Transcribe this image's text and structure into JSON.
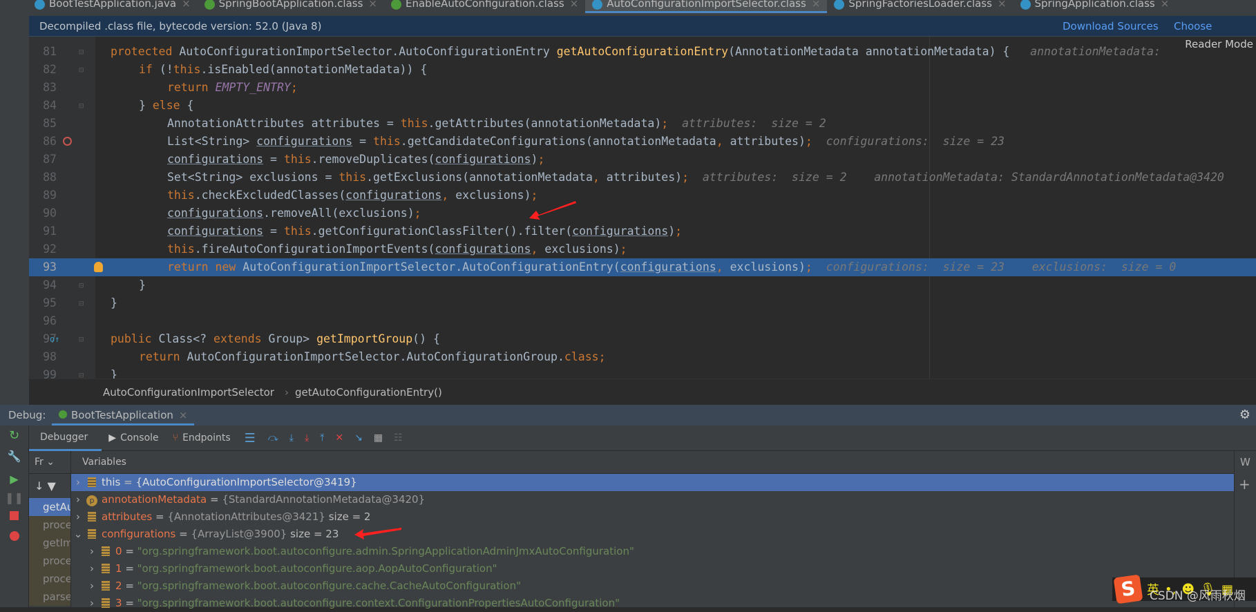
{
  "tabs": [
    {
      "label": "BootTestApplication.java",
      "icon": "java-class-icon",
      "active": false
    },
    {
      "label": "SpringBootApplication.class",
      "icon": "annotation-icon",
      "active": false
    },
    {
      "label": "EnableAutoConfiguration.class",
      "icon": "annotation-icon",
      "active": false
    },
    {
      "label": "AutoConfigurationImportSelector.class",
      "icon": "class-icon",
      "active": true
    },
    {
      "label": "SpringFactoriesLoader.class",
      "icon": "class-icon",
      "active": false
    },
    {
      "label": "SpringApplication.class",
      "icon": "class-icon",
      "active": false
    }
  ],
  "banner": {
    "text": "Decompiled .class file, bytecode version: 52.0 (Java 8)",
    "download": "Download Sources",
    "choose": "Choose Sources"
  },
  "reader_mode": "Reader Mode",
  "code": [
    {
      "n": "81",
      "ind": 1,
      "fold": true,
      "tokens": [
        [
          "kw",
          "protected "
        ],
        [
          "",
          "AutoConfigurationImportSelector.AutoConfigurationEntry "
        ],
        [
          "fn",
          "getAutoConfigurationEntry"
        ],
        [
          "",
          "(AnnotationMetadata annotationMetadata) {   "
        ],
        [
          "hint",
          "annotationMetadata: "
        ]
      ]
    },
    {
      "n": "82",
      "ind": 2,
      "fold": true,
      "tokens": [
        [
          "kw",
          "if "
        ],
        [
          "",
          "(!"
        ],
        [
          "kw",
          "this"
        ],
        [
          "",
          ".isEnabled(annotationMetadata)) {"
        ]
      ]
    },
    {
      "n": "83",
      "ind": 3,
      "tokens": [
        [
          "kw",
          "return "
        ],
        [
          "it",
          "EMPTY_ENTRY"
        ],
        [
          "kw",
          ";"
        ]
      ]
    },
    {
      "n": "84",
      "ind": 2,
      "fold": true,
      "tokens": [
        [
          "",
          "} "
        ],
        [
          "kw",
          "else "
        ],
        [
          "",
          "{"
        ]
      ]
    },
    {
      "n": "85",
      "ind": 3,
      "tokens": [
        [
          "",
          "AnnotationAttributes attributes = "
        ],
        [
          "kw",
          "this"
        ],
        [
          "",
          ".getAttributes(annotationMetadata)"
        ],
        [
          "kw",
          ";"
        ],
        [
          "hint",
          "  attributes:  size = 2"
        ]
      ]
    },
    {
      "n": "86",
      "ind": 3,
      "bp": true,
      "tokens": [
        [
          "",
          "List<String> "
        ],
        [
          "ul",
          "configurations"
        ],
        [
          "",
          " = "
        ],
        [
          "kw",
          "this"
        ],
        [
          "",
          ".getCandidateConfigurations(annotationMetadata"
        ],
        [
          "kw",
          ","
        ],
        [
          "",
          " attributes)"
        ],
        [
          "kw",
          ";"
        ],
        [
          "hint",
          "  configurations:  size = 23"
        ]
      ]
    },
    {
      "n": "87",
      "ind": 3,
      "tokens": [
        [
          "ul",
          "configurations"
        ],
        [
          "",
          " = "
        ],
        [
          "kw",
          "this"
        ],
        [
          "",
          ".removeDuplicates("
        ],
        [
          "ul",
          "configurations"
        ],
        [
          "",
          ")"
        ],
        [
          "kw",
          ";"
        ]
      ]
    },
    {
      "n": "88",
      "ind": 3,
      "tokens": [
        [
          "",
          "Set<String> exclusions = "
        ],
        [
          "kw",
          "this"
        ],
        [
          "",
          ".getExclusions(annotationMetadata"
        ],
        [
          "kw",
          ","
        ],
        [
          "",
          " attributes)"
        ],
        [
          "kw",
          ";"
        ],
        [
          "hint",
          "  attributes:  size = 2    annotationMetadata: StandardAnnotationMetadata@3420"
        ]
      ]
    },
    {
      "n": "89",
      "ind": 3,
      "tokens": [
        [
          "kw",
          "this"
        ],
        [
          "",
          ".checkExcludedClasses("
        ],
        [
          "ul",
          "configurations"
        ],
        [
          "kw",
          ","
        ],
        [
          "",
          " exclusions)"
        ],
        [
          "kw",
          ";"
        ]
      ]
    },
    {
      "n": "90",
      "ind": 3,
      "tokens": [
        [
          "ul",
          "configurations"
        ],
        [
          "",
          ".removeAll(exclusions)"
        ],
        [
          "kw",
          ";"
        ]
      ]
    },
    {
      "n": "91",
      "ind": 3,
      "tokens": [
        [
          "ul",
          "configurations"
        ],
        [
          "",
          " = "
        ],
        [
          "kw",
          "this"
        ],
        [
          "",
          ".getConfigurationClassFilter().filter("
        ],
        [
          "ul",
          "configurations"
        ],
        [
          "",
          ")"
        ],
        [
          "kw",
          ";"
        ]
      ]
    },
    {
      "n": "92",
      "ind": 3,
      "tokens": [
        [
          "kw",
          "this"
        ],
        [
          "",
          ".fireAutoConfigurationImportEvents("
        ],
        [
          "ul",
          "configurations"
        ],
        [
          "kw",
          ","
        ],
        [
          "",
          " exclusions)"
        ],
        [
          "kw",
          ";"
        ]
      ]
    },
    {
      "n": "93",
      "ind": 3,
      "hl": true,
      "bulb": true,
      "tokens": [
        [
          "kw",
          "return new "
        ],
        [
          "",
          "AutoConfigurationImportSelector.AutoConfigurationEntry("
        ],
        [
          "ul",
          "configurations"
        ],
        [
          "kw",
          ","
        ],
        [
          "",
          " exclusions)"
        ],
        [
          "kw",
          ";"
        ],
        [
          "hint",
          "  configurations:  size = 23    exclusions:  size = 0"
        ]
      ]
    },
    {
      "n": "94",
      "ind": 2,
      "fold": true,
      "tokens": [
        [
          "",
          "}"
        ]
      ]
    },
    {
      "n": "95",
      "ind": 1,
      "fold": true,
      "tokens": [
        [
          "",
          "}"
        ]
      ]
    },
    {
      "n": "96",
      "ind": 0,
      "tokens": []
    },
    {
      "n": "97",
      "ind": 1,
      "fold": true,
      "impl": true,
      "tokens": [
        [
          "kw",
          "public "
        ],
        [
          "",
          "Class<? "
        ],
        [
          "kw",
          "extends "
        ],
        [
          "",
          "Group> "
        ],
        [
          "fn",
          "getImportGroup"
        ],
        [
          "",
          "() {"
        ]
      ]
    },
    {
      "n": "98",
      "ind": 2,
      "tokens": [
        [
          "kw",
          "return "
        ],
        [
          "",
          "AutoConfigurationImportSelector.AutoConfigurationGroup."
        ],
        [
          "kw",
          "class"
        ],
        [
          "kw",
          ";"
        ]
      ]
    },
    {
      "n": "99",
      "ind": 1,
      "fold": true,
      "tokens": [
        [
          "",
          "}"
        ]
      ]
    }
  ],
  "breadcrumb": [
    "AutoConfigurationImportSelector",
    "getAutoConfigurationEntry()"
  ],
  "debug": {
    "label": "Debug:",
    "session": "BootTestApplication",
    "tabs": [
      "Debugger",
      "Console",
      "Endpoints"
    ],
    "frames_label": "Fr",
    "variables_label": "Variables",
    "frames": [
      "getAu",
      "proce",
      "getIm",
      "proce",
      "proce",
      "parse"
    ],
    "variables": [
      {
        "name": "this",
        "value": "{AutoConfigurationImportSelector@3419}",
        "extra": "",
        "sel": true,
        "icon": "field-icon"
      },
      {
        "name": "annotationMetadata",
        "value": "{StandardAnnotationMetadata@3420}",
        "extra": "",
        "icon": "parameter-icon"
      },
      {
        "name": "attributes",
        "value": "{AnnotationAttributes@3421}",
        "extra": "size = 2",
        "icon": "field-icon"
      },
      {
        "name": "configurations",
        "value": "{ArrayList@3900}",
        "extra": "size = 23",
        "expanded": true,
        "icon": "field-icon"
      }
    ],
    "children": [
      {
        "index": "0",
        "value": "\"org.springframework.boot.autoconfigure.admin.SpringApplicationAdminJmxAutoConfiguration\""
      },
      {
        "index": "1",
        "value": "\"org.springframework.boot.autoconfigure.aop.AopAutoConfiguration\""
      },
      {
        "index": "2",
        "value": "\"org.springframework.boot.autoconfigure.cache.CacheAutoConfiguration\""
      },
      {
        "index": "3",
        "value": "\"org.springframework.boot.autoconfigure.context.ConfigurationPropertiesAutoConfiguration\""
      }
    ],
    "watches_label": "W",
    "watches_empty": "o w"
  },
  "ime": {
    "logo": "S",
    "mode": "英"
  },
  "watermark": "CSDN @风雨秋烟",
  "colors": {
    "accent": "#4a88c7",
    "selection": "#4b6eaf",
    "highlight_line": "#2d5c94",
    "keyword": "#cc7832",
    "string": "#6a8759",
    "annotation_arrow": "#ff2020"
  }
}
